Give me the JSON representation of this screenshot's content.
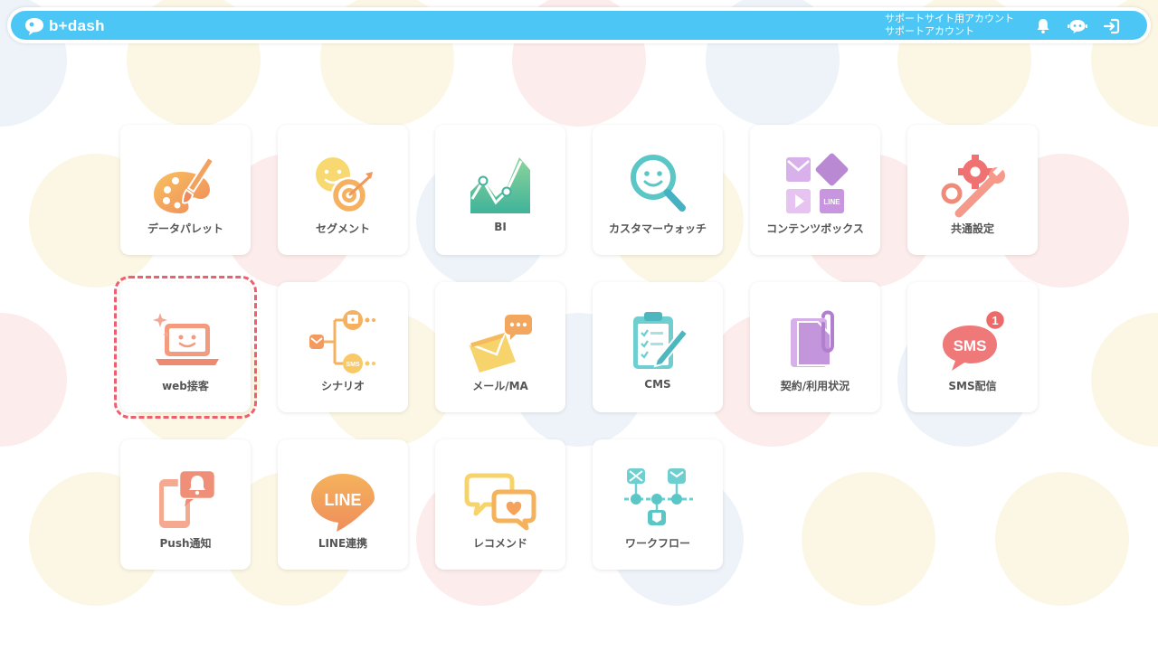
{
  "header": {
    "logo_text": "b+dash",
    "account_line1": "サポートサイト用アカウント",
    "account_line2": "サポートアカウント",
    "icons": [
      "bell-icon",
      "chat-bot-icon",
      "logout-icon"
    ],
    "bar_color": "#4cc7f5"
  },
  "menu": {
    "selected": "web接客",
    "tiles": [
      {
        "label": "データパレット",
        "icon": "palette-icon"
      },
      {
        "label": "セグメント",
        "icon": "segment-target-icon"
      },
      {
        "label": "BI",
        "icon": "bi-chart-icon"
      },
      {
        "label": "カスタマーウォッチ",
        "icon": "magnifier-face-icon"
      },
      {
        "label": "コンテンツボックス",
        "icon": "content-box-icon"
      },
      {
        "label": "共通設定",
        "icon": "gear-wrench-icon"
      },
      {
        "label": "web接客",
        "icon": "laptop-face-icon"
      },
      {
        "label": "シナリオ",
        "icon": "scenario-flow-icon"
      },
      {
        "label": "メール/MA",
        "icon": "envelope-icon"
      },
      {
        "label": "CMS",
        "icon": "clipboard-pen-icon"
      },
      {
        "label": "契約/利用状況",
        "icon": "document-clip-icon"
      },
      {
        "label": "SMS配信",
        "icon": "sms-bubble-icon",
        "badge": "1"
      },
      {
        "label": "Push通知",
        "icon": "phone-bell-icon"
      },
      {
        "label": "LINE連携",
        "icon": "line-bubble-icon",
        "text": "LINE"
      },
      {
        "label": "レコメンド",
        "icon": "chat-heart-icon"
      },
      {
        "label": "ワークフロー",
        "icon": "workflow-icon"
      }
    ]
  },
  "colors": {
    "orange": "#f4a15f",
    "yellow": "#f6cd6a",
    "green": "#5cc39a",
    "teal": "#5bc6c6",
    "purple": "#c08fd6",
    "red": "#ef7171",
    "selected_outline": "#ee5f6e"
  }
}
